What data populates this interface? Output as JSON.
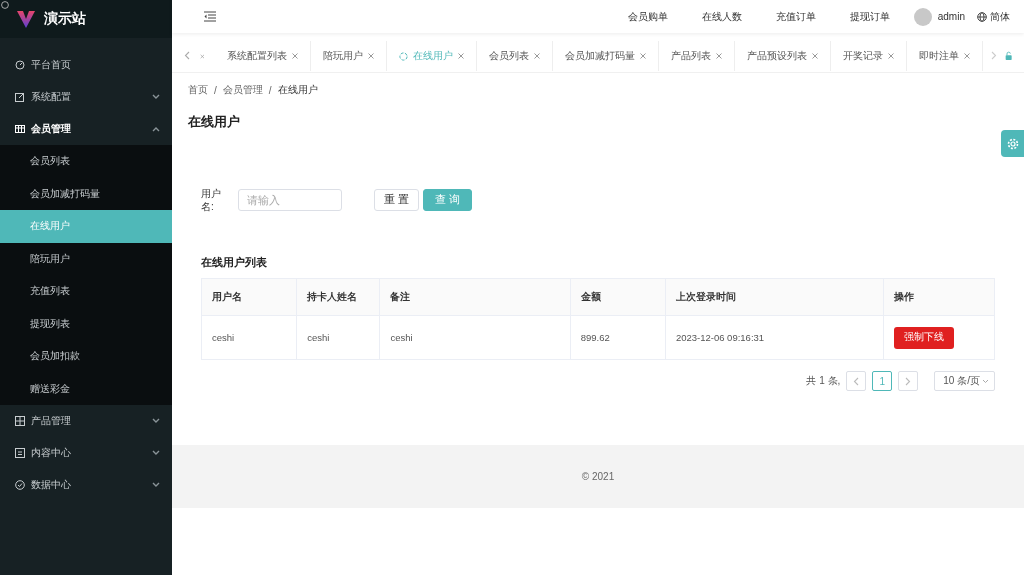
{
  "app": {
    "title": "演示站"
  },
  "sidebar": {
    "items": [
      {
        "label": "平台首页"
      },
      {
        "label": "系统配置",
        "expanded": false
      },
      {
        "label": "会员管理",
        "expanded": true,
        "children": [
          {
            "label": "会员列表",
            "selected": false
          },
          {
            "label": "会员加减打码量",
            "selected": false
          },
          {
            "label": "在线用户",
            "selected": true
          },
          {
            "label": "陪玩用户",
            "selected": false
          },
          {
            "label": "充值列表",
            "selected": false
          },
          {
            "label": "提现列表",
            "selected": false
          },
          {
            "label": "会员加扣款",
            "selected": false
          },
          {
            "label": "赠送彩金",
            "selected": false
          }
        ]
      },
      {
        "label": "产品管理",
        "expanded": false
      },
      {
        "label": "内容中心",
        "expanded": false
      },
      {
        "label": "数据中心",
        "expanded": false
      }
    ]
  },
  "header": {
    "links": [
      "会员购单",
      "在线人数",
      "充值订单",
      "提现订单"
    ],
    "user": "admin",
    "language": "简体"
  },
  "tabs": [
    {
      "label": "系统配置列表",
      "selected": false
    },
    {
      "label": "陪玩用户",
      "selected": false
    },
    {
      "label": "在线用户",
      "selected": true
    },
    {
      "label": "会员列表",
      "selected": false
    },
    {
      "label": "会员加减打码量",
      "selected": false
    },
    {
      "label": "产品列表",
      "selected": false
    },
    {
      "label": "产品预设列表",
      "selected": false
    },
    {
      "label": "开奖记录",
      "selected": false
    },
    {
      "label": "即时注单",
      "selected": false
    }
  ],
  "breadcrumb": {
    "items": [
      "首页",
      "会员管理",
      "在线用户"
    ],
    "separator": "/"
  },
  "page_title": "在线用户",
  "filter": {
    "label": "用户名:",
    "placeholder": "请输入",
    "buttons": [
      {
        "label": "重 置",
        "kind": "plain"
      },
      {
        "label": "查 询",
        "kind": "primary"
      }
    ]
  },
  "table": {
    "title": "在线用户列表",
    "columns": [
      "用户名",
      "持卡人姓名",
      "备注",
      "金额",
      "上次登录时间",
      "操作"
    ],
    "rows": [
      {
        "cells": [
          "ceshi",
          "ceshi",
          "ceshi",
          "899.62",
          "2023-12-06 09:16:31"
        ],
        "action": "强制下线"
      }
    ]
  },
  "pagination": {
    "total": "共 1 条,",
    "pages": [
      {
        "label": "1",
        "selected": true
      }
    ],
    "page_size": "10 条/页"
  },
  "footer": "© 2021"
}
